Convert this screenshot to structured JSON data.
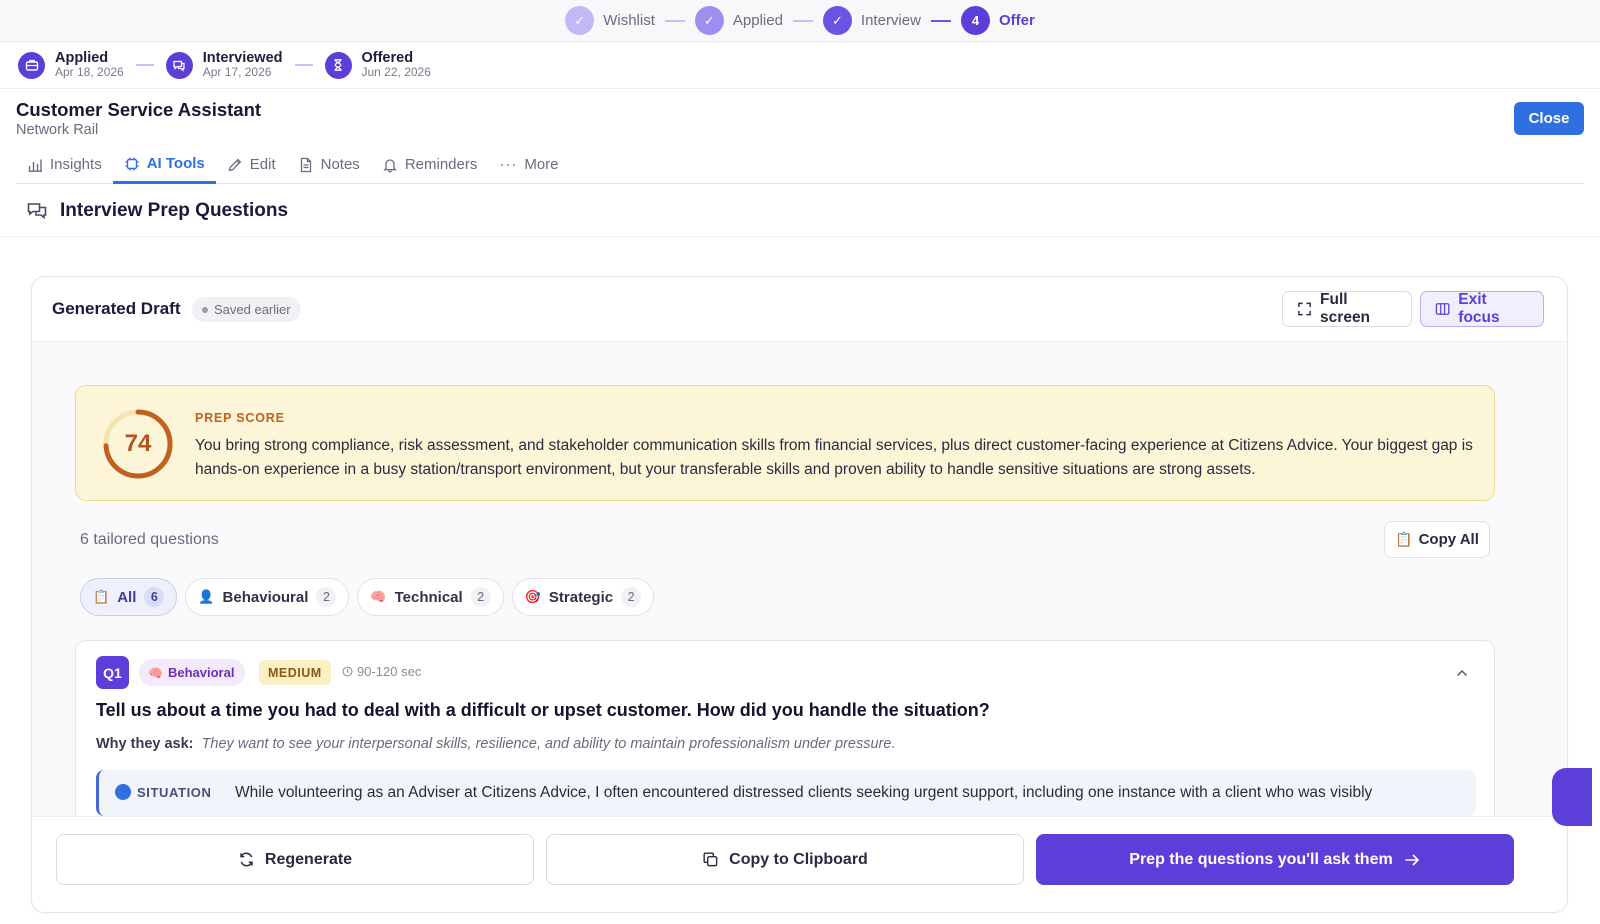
{
  "stepper": {
    "steps": [
      {
        "label": "Wishlist",
        "mark": "✓"
      },
      {
        "label": "Applied",
        "mark": "✓"
      },
      {
        "label": "Interview",
        "mark": "✓"
      },
      {
        "label": "Offer",
        "mark": "4"
      }
    ]
  },
  "history": [
    {
      "label": "Applied",
      "date": "Apr 18, 2026",
      "icon": "briefcase-icon"
    },
    {
      "label": "Interviewed",
      "date": "Apr 17, 2026",
      "icon": "chat-icon"
    },
    {
      "label": "Offered",
      "date": "Jun 22, 2026",
      "icon": "hourglass-icon"
    }
  ],
  "job": {
    "title": "Customer Service Assistant",
    "company": "Network Rail",
    "close_label": "Close"
  },
  "tabs": [
    {
      "label": "Insights",
      "icon": "bar-chart-icon"
    },
    {
      "label": "AI Tools",
      "icon": "chip-icon",
      "active": true
    },
    {
      "label": "Edit",
      "icon": "pencil-icon"
    },
    {
      "label": "Notes",
      "icon": "document-icon"
    },
    {
      "label": "Reminders",
      "icon": "bell-icon"
    },
    {
      "label": "More",
      "icon": "ellipsis-icon"
    }
  ],
  "section": {
    "title": "Interview Prep Questions",
    "icon": "chat-bubbles-icon"
  },
  "draft": {
    "title": "Generated Draft",
    "status": "Saved earlier",
    "full_screen_label": "Full screen",
    "exit_focus_label": "Exit focus"
  },
  "score": {
    "value": "74",
    "fraction": 0.74,
    "label": "PREP SCORE",
    "text": "You bring strong compliance, risk assessment, and stakeholder communication skills from financial services, plus direct customer-facing experience at Citizens Advice. Your biggest gap is hands-on experience in a busy station/transport environment, but your transferable skills and proven ability to handle sensitive situations are strong assets."
  },
  "questions_summary": {
    "count_label": "6 tailored questions",
    "copy_all_label": "Copy All"
  },
  "filters": [
    {
      "label": "All",
      "count": "6",
      "icon": "📋",
      "active": true
    },
    {
      "label": "Behavioural",
      "count": "2",
      "icon": "👤"
    },
    {
      "label": "Technical",
      "count": "2",
      "icon": "🧠"
    },
    {
      "label": "Strategic",
      "count": "2",
      "icon": "🎯"
    }
  ],
  "question": {
    "number": "Q1",
    "type": "Behavioral",
    "type_icon": "🧠",
    "difficulty": "MEDIUM",
    "duration": "90-120 sec",
    "text": "Tell us about a time you had to deal with a difficult or upset customer. How did you handle the situation?",
    "why_label": "Why they ask:",
    "why_text": "They want to see your interpersonal skills, resilience, and ability to maintain professionalism under pressure.",
    "star_label": "SITUATION",
    "star_text": "While volunteering as an Adviser at Citizens Advice, I often encountered distressed clients seeking urgent support, including one instance with a client who was visibly"
  },
  "footer": {
    "regenerate_label": "Regenerate",
    "copy_label": "Copy to Clipboard",
    "prep_label": "Prep the questions you'll ask them"
  },
  "colors": {
    "accent": "#5b3fd8",
    "primary_blue": "#2f6fe0",
    "score_ring": "#c2611f"
  }
}
